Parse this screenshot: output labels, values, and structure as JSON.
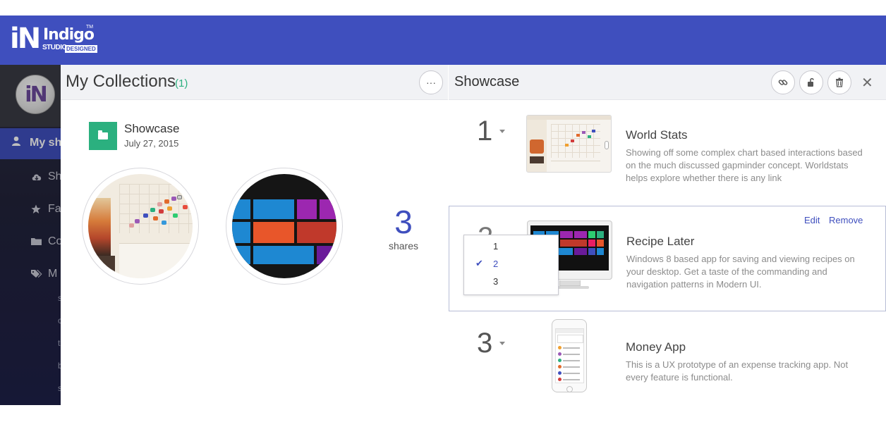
{
  "brand": {
    "logo_mark": "iN",
    "logo_word": "Indigo",
    "logo_tm": "TM",
    "logo_studio": "STUDIO",
    "logo_designed": "DESIGNED",
    "accent_color": "#3f4fbe",
    "green_color": "#2bb07f"
  },
  "sidebar": {
    "avatar_text": "iN",
    "active_item": {
      "icon": "user-icon",
      "label": "My sh"
    },
    "items": [
      {
        "icon": "cloud-icon",
        "label": "Sh"
      },
      {
        "icon": "star-icon",
        "label": "Fa"
      },
      {
        "icon": "folder-icon",
        "label": "Co"
      },
      {
        "icon": "tags-icon",
        "label": "M"
      }
    ],
    "tags": [
      "s",
      "c",
      "t",
      "b",
      "s"
    ]
  },
  "collections": {
    "title": "My Collections",
    "count": "(1)",
    "more_label": "···",
    "collection": {
      "name": "Showcase",
      "date": "July 27, 2015",
      "shares_count": "3",
      "shares_label": "shares"
    }
  },
  "showcase": {
    "title": "Showcase",
    "close_label": "✕",
    "edit_label": "Edit",
    "remove_label": "Remove",
    "items": [
      {
        "rank": "1",
        "title": "World Stats",
        "description": "Showing off some complex chart based interactions based on the much discussed gapminder concept. Worldstats helps explore whether there is any link"
      },
      {
        "rank": "2",
        "title": "Recipe Later",
        "description": "Windows 8 based app for saving and viewing recipes on your  desktop. Get a taste of the commanding and navigation patterns in Modern UI."
      },
      {
        "rank": "3",
        "title": "Money App",
        "description": "This is a UX prototype of an expense tracking app. Not every feature is functional."
      }
    ]
  },
  "rank_dropdown": {
    "options": [
      "1",
      "2",
      "3"
    ],
    "selected": "2"
  }
}
